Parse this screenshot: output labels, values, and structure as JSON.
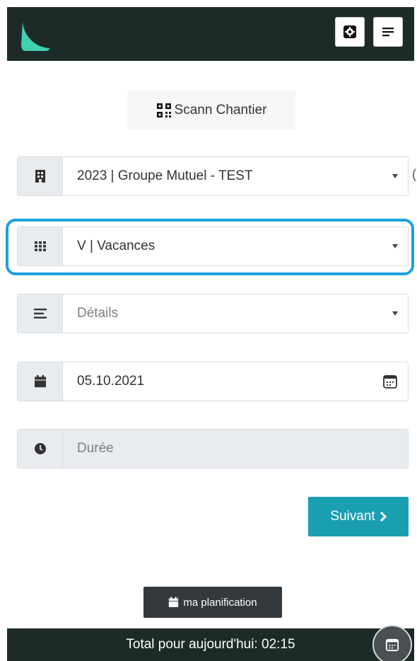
{
  "header": {
    "brand": "logo",
    "settings_icon": "gear-icon",
    "menu_icon": "menu-icon"
  },
  "scan": {
    "label": "Scann Chantier",
    "icon": "qrcode-icon"
  },
  "form": {
    "project": {
      "icon": "building-icon",
      "value": "2023 | Groupe Mutuel - TEST"
    },
    "activity": {
      "icon": "grid-icon",
      "value": "V | Vacances"
    },
    "details": {
      "icon": "list-icon",
      "placeholder": "Détails"
    },
    "date": {
      "icon": "calendar-icon",
      "value": "05.10.2021",
      "picker_icon": "calendar-picker-icon"
    },
    "duration": {
      "icon": "clock-icon",
      "placeholder": "Durée"
    }
  },
  "actions": {
    "next_label": "Suivant",
    "planification_label": "ma planification"
  },
  "footer": {
    "total_text": "Total pour aujourd'hui: 02:15"
  },
  "colors": {
    "header_bg": "#1c2b28",
    "accent_teal": "#1a9fb1",
    "logo": "#3fd1b0",
    "highlight": "#1aa1e0"
  }
}
